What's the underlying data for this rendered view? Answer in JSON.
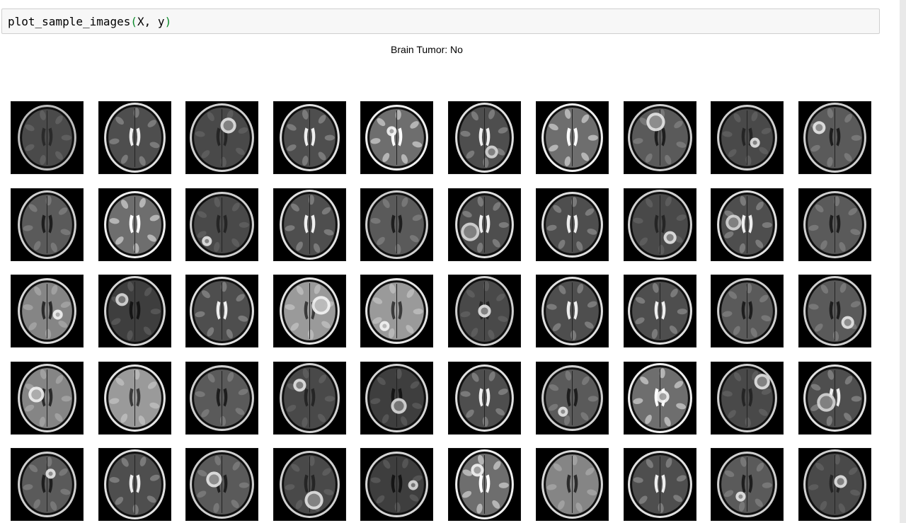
{
  "code": {
    "function": "plot_sample_images",
    "open": "(",
    "args": "X, y",
    "close": ")"
  },
  "figure": {
    "title": "Brain Tumor: No"
  },
  "grid": {
    "rows": 5,
    "columns": 10,
    "tiles": [
      {
        "variant": "flair-dark",
        "lesion": false
      },
      {
        "variant": "t2",
        "lesion": false
      },
      {
        "variant": "t1-contrast",
        "lesion": true
      },
      {
        "variant": "t2",
        "lesion": false
      },
      {
        "variant": "t2-bright",
        "lesion": true
      },
      {
        "variant": "t2",
        "lesion": true
      },
      {
        "variant": "t2-bright",
        "lesion": false
      },
      {
        "variant": "flair",
        "lesion": true
      },
      {
        "variant": "t1-contrast",
        "lesion": true
      },
      {
        "variant": "flair",
        "lesion": true
      },
      {
        "variant": "flair",
        "lesion": false
      },
      {
        "variant": "t2-bright",
        "lesion": false
      },
      {
        "variant": "t1-contrast",
        "lesion": true
      },
      {
        "variant": "t2",
        "lesion": false
      },
      {
        "variant": "flair",
        "lesion": false
      },
      {
        "variant": "t2",
        "lesion": true
      },
      {
        "variant": "t2",
        "lesion": false
      },
      {
        "variant": "t1-contrast",
        "lesion": true
      },
      {
        "variant": "t2",
        "lesion": true
      },
      {
        "variant": "flair",
        "lesion": false
      },
      {
        "variant": "flair-light",
        "lesion": true
      },
      {
        "variant": "t1",
        "lesion": true
      },
      {
        "variant": "t2",
        "lesion": false
      },
      {
        "variant": "t1-light",
        "lesion": true
      },
      {
        "variant": "t1-light",
        "lesion": true
      },
      {
        "variant": "t1-contrast",
        "lesion": true
      },
      {
        "variant": "t2",
        "lesion": false
      },
      {
        "variant": "t2",
        "lesion": false
      },
      {
        "variant": "flair",
        "lesion": false
      },
      {
        "variant": "flair",
        "lesion": true
      },
      {
        "variant": "flair-light",
        "lesion": true
      },
      {
        "variant": "t1-light",
        "lesion": false
      },
      {
        "variant": "flair",
        "lesion": false
      },
      {
        "variant": "t1-contrast",
        "lesion": true
      },
      {
        "variant": "t1",
        "lesion": true
      },
      {
        "variant": "t2",
        "lesion": false
      },
      {
        "variant": "flair",
        "lesion": true
      },
      {
        "variant": "t2-bright",
        "lesion": true
      },
      {
        "variant": "t1-contrast",
        "lesion": true
      },
      {
        "variant": "t2",
        "lesion": true
      },
      {
        "variant": "flair",
        "lesion": true
      },
      {
        "variant": "t2",
        "lesion": false
      },
      {
        "variant": "flair",
        "lesion": true
      },
      {
        "variant": "t1-contrast",
        "lesion": true
      },
      {
        "variant": "t1",
        "lesion": true
      },
      {
        "variant": "t2-bright",
        "lesion": true
      },
      {
        "variant": "flair-light",
        "lesion": false
      },
      {
        "variant": "t2",
        "lesion": false
      },
      {
        "variant": "flair",
        "lesion": true
      },
      {
        "variant": "t1-contrast",
        "lesion": true
      }
    ]
  },
  "colors": {
    "paren": "#0b8a2a",
    "cell_background": "#f7f7f7",
    "cell_border": "#cfcfcf"
  }
}
